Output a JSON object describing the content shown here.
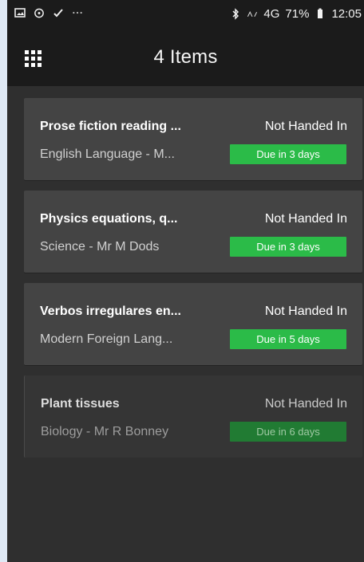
{
  "status_bar": {
    "icons": [
      "photo-icon",
      "sync-icon",
      "check-mark-icon",
      "more-dots-icon",
      "bluetooth-icon",
      "signal-icon"
    ],
    "signal_text": "4G",
    "battery": "71%",
    "time": "12:05"
  },
  "header": {
    "title": "4 Items",
    "menu_icon": "grid-icon"
  },
  "items": [
    {
      "title": "Prose fiction reading ...",
      "subtitle": "English Language - M...",
      "status": "Not Handed In",
      "due": "Due in 3 days"
    },
    {
      "title": "Physics equations, q...",
      "subtitle": "Science - Mr M Dods",
      "status": "Not Handed In",
      "due": "Due in 3 days"
    },
    {
      "title": "Verbos irregulares en...",
      "subtitle": "Modern Foreign Lang...",
      "status": "Not Handed In",
      "due": "Due in 5 days"
    },
    {
      "title": "Plant tissues",
      "subtitle": "Biology - Mr R Bonney",
      "status": "Not Handed In",
      "due": "Due in 6 days"
    }
  ],
  "colors": {
    "page_background": "#2f2f2f",
    "app_bar": "#1b1b1b",
    "card": "#444444",
    "accent_green": "#2bbb48",
    "faded_green": "#217b33"
  }
}
